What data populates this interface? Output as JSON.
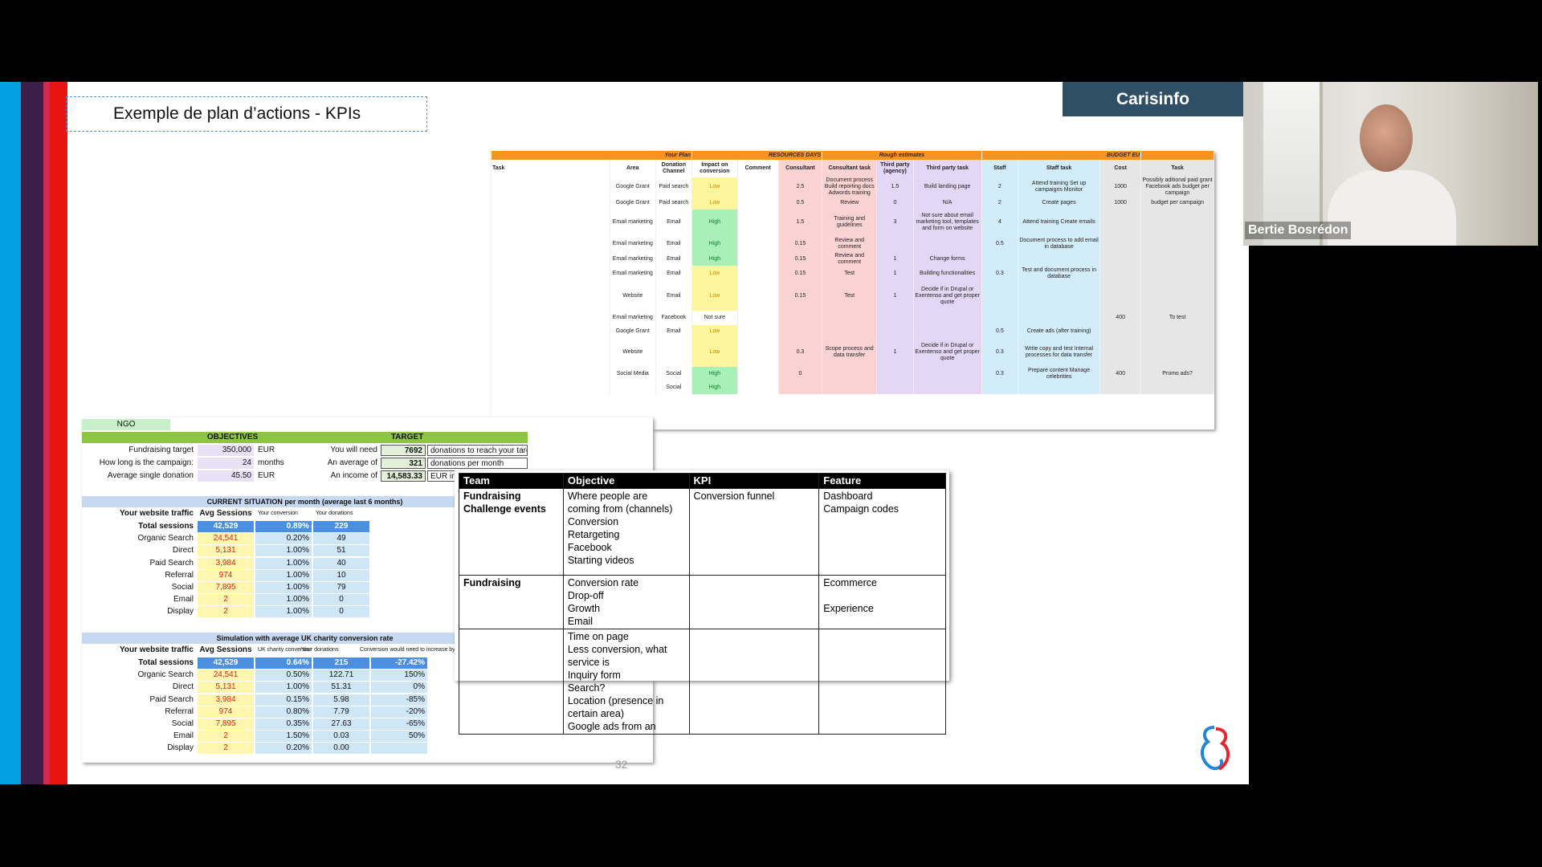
{
  "slide": {
    "title": "Exemple de plan d’actions - KPIs",
    "brand": "Carisinfo",
    "page_number": "32",
    "stripe_colors": [
      "#00a0e3",
      "#3b1f4a",
      "#d42a50",
      "#e8140f"
    ]
  },
  "webcam": {
    "participant_name": "Bertie Bosrédon"
  },
  "plan_sheet": {
    "group_headers": [
      "Your Plan",
      "RESOURCES DAYS",
      "Rough estimates",
      "BUDGET EU"
    ],
    "columns": [
      "Task",
      "Area",
      "Donation Channel",
      "Impact on conversion",
      "Comment",
      "Consultant",
      "Consultant task",
      "Third party (agency)",
      "Third party task",
      "Staff",
      "Staff task",
      "Cost",
      "Task"
    ],
    "rows": [
      [
        "",
        "Google Grant",
        "Paid search",
        "Low",
        "",
        "2.5",
        "Document process Build reporting docs Adwords training",
        "1.5",
        "Build landing page",
        "2",
        "Attend training Set up campaigns Monitor",
        "1000",
        "Possibly aditional paid grant Facebook ads budget per campaign"
      ],
      [
        "",
        "Google Grant",
        "Paid search",
        "Low",
        "",
        "0.5",
        "Review",
        "0",
        "N/A",
        "2",
        "Create pages",
        "1000",
        "budget per campaign"
      ],
      [
        "",
        "Email marketing",
        "Email",
        "High",
        "",
        "1.5",
        "Training and guidelines",
        "3",
        "Not sure about email marketing tool, templates and form on website",
        "4",
        "Attend training Create emails",
        "",
        ""
      ],
      [
        "",
        "Email marketing",
        "Email",
        "High",
        "",
        "0.15",
        "Review and comment",
        "",
        "",
        "0.5",
        "Document process to add email in database",
        "",
        ""
      ],
      [
        "",
        "Email marketing",
        "Email",
        "High",
        "",
        "0.15",
        "Review and comment",
        "1",
        "Change forms",
        "",
        "",
        "",
        ""
      ],
      [
        "",
        "Email marketing",
        "Email",
        "Low",
        "",
        "0.15",
        "Test",
        "1",
        "Building functionalities",
        "0.3",
        "Test and document process in database",
        "",
        ""
      ],
      [
        "",
        "Website",
        "Email",
        "Low",
        "",
        "0.15",
        "Test",
        "1",
        "Decide if in Drupal or Exentenso and get proper quote",
        "",
        "",
        "",
        ""
      ],
      [
        "",
        "Email marketing",
        "Facebook",
        "Not sure",
        "",
        "",
        "",
        "",
        "",
        "",
        "",
        "400",
        "To test"
      ],
      [
        "",
        "Google Grant",
        "Email",
        "Low",
        "",
        "",
        "",
        "",
        "",
        "0.5",
        "Create ads (after training)",
        "",
        ""
      ],
      [
        "",
        "Website",
        "",
        "Low",
        "",
        "0.3",
        "Scope process and data transfer",
        "1",
        "Decide if in Drupal or Exentenso and get proper quote",
        "0.3",
        "Write copy and test Internal processes for data transfer",
        "",
        ""
      ],
      [
        "",
        "Social Media",
        "Social",
        "High",
        "",
        "0",
        "",
        "",
        "",
        "0.3",
        "Prepare content Manage celebrities",
        "400",
        "Promo ads?"
      ],
      [
        "",
        "",
        "Social",
        "High",
        "",
        "",
        "",
        "",
        "",
        "",
        "",
        "",
        ""
      ]
    ]
  },
  "ngo_sheet": {
    "ngo_label": "NGO",
    "objectives_label": "OBJECTIVES",
    "target_label": "TARGET",
    "objectives": [
      {
        "label": "Fundraising target",
        "value": "350,000",
        "unit": "EUR",
        "t_label": "You will need",
        "t_value": "7692",
        "t_text": "donations to reach your target"
      },
      {
        "label": "How long is the campaign:",
        "value": "24",
        "unit": "months",
        "t_label": "An average of",
        "t_value": "321",
        "t_text": "donations per month"
      },
      {
        "label": "Average single donation",
        "value": "45.50",
        "unit": "EUR",
        "t_label": "An income of",
        "t_value": "14,583.33",
        "t_text": "EUR income"
      }
    ],
    "current": {
      "title": "CURRENT SITUATION per month (average last 6 months)",
      "h_traffic": "Your website traffic",
      "h_sessions": "Avg Sessions",
      "h_conv": "Your conversion",
      "h_don": "Your donations",
      "rows": [
        [
          "Total sessions",
          "42,529",
          "0.89%",
          "229"
        ],
        [
          "Organic Search",
          "24,541",
          "0.20%",
          "49"
        ],
        [
          "Direct",
          "5,131",
          "1.00%",
          "51"
        ],
        [
          "Paid Search",
          "3,984",
          "1.00%",
          "40"
        ],
        [
          "Referral",
          "974",
          "1.00%",
          "10"
        ],
        [
          "Social",
          "7,895",
          "1.00%",
          "79"
        ],
        [
          "Email",
          "2",
          "1.00%",
          "0"
        ],
        [
          "Display",
          "2",
          "1.00%",
          "0"
        ]
      ]
    },
    "simulation": {
      "title": "Simulation with average UK charity conversion rate",
      "h_traffic": "Your website traffic",
      "h_sessions": "Avg Sessions",
      "h_uk": "UK charity conversion",
      "h_don": "Your donations",
      "h_incr": "Conversion would need to increase by",
      "rows": [
        [
          "Total sessions",
          "42,529",
          "0.64%",
          "215",
          "-27.42%"
        ],
        [
          "Organic Search",
          "24,541",
          "0.50%",
          "122.71",
          "150%"
        ],
        [
          "Direct",
          "5,131",
          "1.00%",
          "51.31",
          "0%"
        ],
        [
          "Paid Search",
          "3,984",
          "0.15%",
          "5.98",
          "-85%"
        ],
        [
          "Referral",
          "974",
          "0.80%",
          "7.79",
          "-20%"
        ],
        [
          "Social",
          "7,895",
          "0.35%",
          "27.63",
          "-65%"
        ],
        [
          "Email",
          "2",
          "1.50%",
          "0.03",
          "50%"
        ],
        [
          "Display",
          "2",
          "0.20%",
          "0.00",
          ""
        ]
      ]
    }
  },
  "kpi_table": {
    "headers": [
      "Team",
      "Objective",
      "KPI",
      "Feature"
    ],
    "rows": [
      {
        "team": "Fundraising\nChallenge events",
        "objective": "Where people are\ncoming from (channels)\nConversion\nRetargeting\nFacebook\nStarting videos",
        "kpi": "Conversion funnel",
        "feature": "Dashboard\nCampaign codes"
      },
      {
        "team": "Fundraising",
        "objective": "Conversion rate\nDrop-off\nGrowth\nEmail",
        "kpi": "",
        "feature": "Ecommerce\n\nExperience"
      },
      {
        "team": "",
        "objective": "Time on page\nLess conversion, what\nservice is\nInquiry form\nSearch?\nLocation (presence in\ncertain area)\nGoogle ads from an",
        "kpi": "",
        "feature": ""
      }
    ]
  }
}
